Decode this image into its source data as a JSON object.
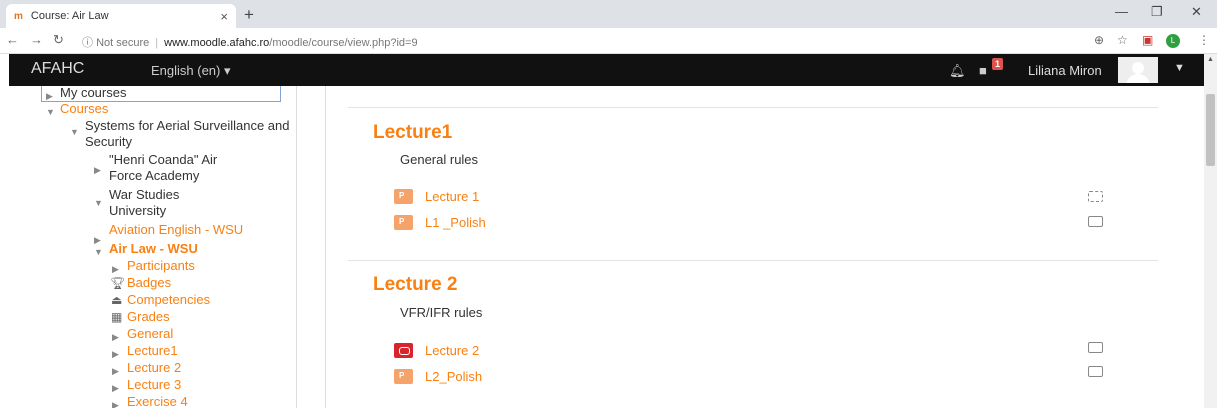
{
  "browser": {
    "tab_title": "Course: Air Law",
    "tab_favicon": "moodle-logo",
    "url_prefix": "Not secure",
    "url_host": "www.moodle.afahc.ro",
    "url_path": "/moodle/course/view.php?id=9",
    "extension_letter": "L"
  },
  "navbar": {
    "brand": "AFAHC",
    "language": "English (en) ▾",
    "notification_count": "1",
    "user_name": "Liliana Miron"
  },
  "leftnav": {
    "my_courses": "My courses",
    "courses": "Courses",
    "category_1": "Systems for Aerial Surveillance and Security",
    "category_2": "\"Henri Coanda\" Air Force Academy",
    "category_3": "War Studies University",
    "course_1": "Aviation English - WSU",
    "course_current": "Air Law - WSU",
    "items": [
      "Participants",
      "Badges",
      "Competencies",
      "Grades",
      "General",
      "Lecture1",
      "Lecture 2",
      "Lecture 3",
      "Exercise 4"
    ]
  },
  "main": {
    "sections": [
      {
        "title": "Lecture1",
        "summary": "General rules",
        "activities": [
          {
            "name": "Lecture 1",
            "type": "ppt-icon"
          },
          {
            "name": "L1 _Polish",
            "type": "ppt-icon"
          }
        ]
      },
      {
        "title": "Lecture 2",
        "summary": "VFR/IFR rules",
        "activities": [
          {
            "name": "Lecture 2",
            "type": "pdf-icon"
          },
          {
            "name": "L2_Polish",
            "type": "ppt-icon"
          }
        ]
      }
    ]
  },
  "colors": {
    "accent": "#f98012",
    "navbar": "#111111"
  }
}
